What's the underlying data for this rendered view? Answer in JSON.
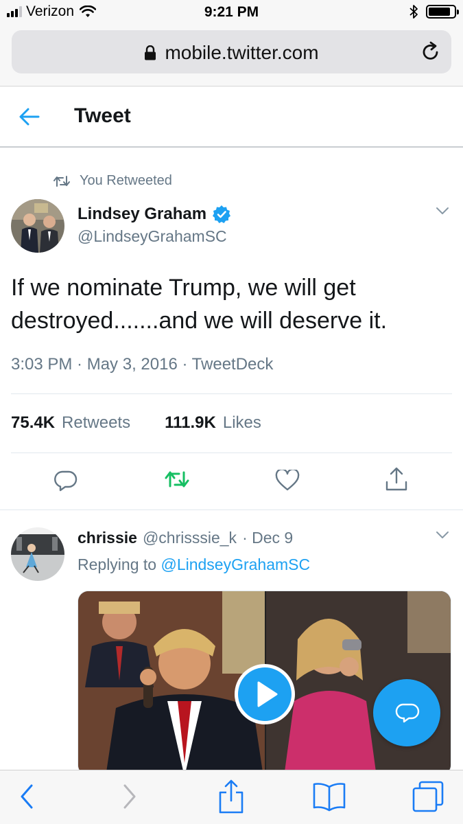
{
  "status_bar": {
    "carrier": "Verizon",
    "time": "9:21 PM",
    "battery_level": 0.85
  },
  "browser": {
    "url": "mobile.twitter.com",
    "icons": [
      "lock-icon",
      "reload-icon",
      "back-icon",
      "forward-icon",
      "share-icon",
      "bookmarks-icon",
      "tabs-icon"
    ]
  },
  "header": {
    "title": "Tweet"
  },
  "tweet": {
    "retweet_context": "You Retweeted",
    "author_name": "Lindsey Graham",
    "author_handle": "@LindseyGrahamSC",
    "verified": true,
    "text": "If we nominate Trump, we will get destroyed.......and we will deserve it.",
    "meta": "3:03 PM · May 3, 2016 · TweetDeck",
    "stats": {
      "retweets_count": "75.4K",
      "retweets_label": "Retweets",
      "likes_count": "111.9K",
      "likes_label": "Likes"
    },
    "retweeted": true
  },
  "reply": {
    "author_name": "chrissie",
    "author_handle": "@chrisssie_k",
    "date": "· Dec 9",
    "replying_prefix": "Replying to",
    "replying_to": "@LindseyGrahamSC"
  },
  "colors": {
    "accent": "#1da1f2",
    "retweet_green": "#17bf63",
    "secondary_text": "#657786"
  }
}
